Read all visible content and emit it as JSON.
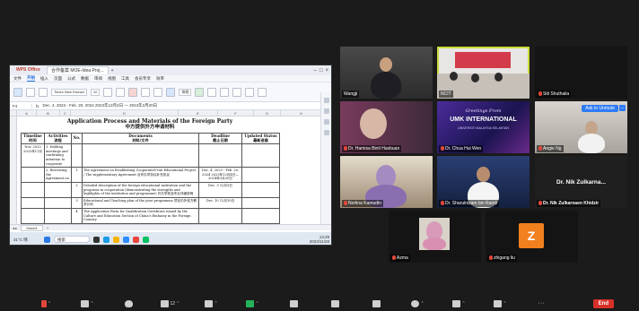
{
  "window": {
    "wps_label": "WPS Office",
    "tab_title": "合作备案 MOE-Idea Proj...",
    "add_tab": "+",
    "controls": [
      "–",
      "□",
      "×"
    ]
  },
  "menu": {
    "items": [
      "文件",
      "开始",
      "插入",
      "页面",
      "公式",
      "数据",
      "审阅",
      "视图",
      "工具",
      "会员专享",
      "效率"
    ],
    "active_index": 1
  },
  "ribbon": {
    "font_name": "Times New Roman",
    "font_size": "10",
    "number_format": "常规"
  },
  "formula_bar": {
    "cell_ref": "F4",
    "content": "Dec. 4, 2023 - Feb. 20, 2024 2023年12月4日 — 2024年2月20日"
  },
  "columns": [
    "A",
    "B",
    "C",
    "D",
    "E",
    "F",
    "G",
    "H"
  ],
  "document": {
    "title": "Application Process and Materials of the Foreign Party",
    "subtitle": "中方提供外方申请材料",
    "headers": [
      {
        "en": "Timeline",
        "zh": "时间"
      },
      {
        "en": "Activities",
        "zh": "流程"
      },
      {
        "en": "No.",
        "zh": ""
      },
      {
        "en": "Documents",
        "zh": "材料/文件"
      },
      {
        "en": "Deadline",
        "zh": "截止日期"
      },
      {
        "en": "Updated Status",
        "zh": "最新进展"
      }
    ],
    "rows": [
      {
        "timeline": "Nov. 2023 2023年11月",
        "activity": "1. Holding meetings and confirming intention to cooperate",
        "no": "",
        "doc": "",
        "deadline": "",
        "status": ""
      },
      {
        "timeline": "",
        "activity": "2. Reviewing the Agreement on",
        "no": "1",
        "doc": "The Agreement on Establishing Cooperative-run Educational Project / The supplementary Agreement 合作办学协议补充协议",
        "deadline": "Dec. 4, 2023 - Feb. 20, 2024 2023年12月4日—2024年2月20日",
        "status": ""
      },
      {
        "timeline": "",
        "activity": "",
        "no": "2",
        "doc": "Detailed description of the foreign educational institution and the programs in cooperation (demonstrating the strengths and highlights of the institution and programme) 外方学校及专业详细说明",
        "deadline": "Dec. 3 12月3日",
        "status": ""
      },
      {
        "timeline": "",
        "activity": "",
        "no": "3",
        "doc": "Educational and Teaching plan of the joint programme 项目中外双方教学计划",
        "deadline": "Dec. 10 12月10日",
        "status": ""
      },
      {
        "timeline": "",
        "activity": "",
        "no": "4",
        "doc": "The Application Form for Qualification Certificate issued by the Culture and Education Section of China's Embassy in the Foreign Country",
        "deadline": "",
        "status": ""
      }
    ]
  },
  "sheet_tabs": [
    "Sheet1"
  ],
  "taskbar": {
    "weather": "31°C 晴",
    "search_placeholder": "搜索",
    "time": "13:29",
    "date": "2023/11/28"
  },
  "participants": [
    {
      "name": "Wangji",
      "muted": false
    },
    {
      "name": "NCIT",
      "muted": false,
      "active": true
    },
    {
      "name": "Siti Shuthaila",
      "muted": true
    },
    {
      "name": "Dr. Hamisa Binti Hasbuan",
      "muted": true
    },
    {
      "name": "Dr. Chua Hui Wen",
      "muted": true
    },
    {
      "name": "Angie Ng",
      "muted": true
    },
    {
      "name": "Norlina Kamudin",
      "muted": true
    },
    {
      "name": "Dr. Sharulnizam bin Ramli",
      "muted": true
    },
    {
      "name": "Dr. Nik Zulkarnaen Khidzir",
      "muted": true
    },
    {
      "name": "Azma",
      "muted": true
    },
    {
      "name": "zhigang liu",
      "muted": true
    }
  ],
  "text_tile_name": "Dr. Nik Zulkarna...",
  "avatar_letter": "Z",
  "slide_text": {
    "greeting": "Greetings From",
    "org": "UMK INTERNATIONAL",
    "suffix": "UNIVERSITI MALAYSIA KELANTAN"
  },
  "ask_to_unmute": "Ask to Unmute",
  "ask_more": "...",
  "toolbar": {
    "participants_count": "12",
    "end_label": "End"
  },
  "colors": {
    "active_speaker": "#c9dc3a",
    "end_button": "#d8312a",
    "unmute_button": "#2e7cf6",
    "avatar": "#f2801e"
  }
}
